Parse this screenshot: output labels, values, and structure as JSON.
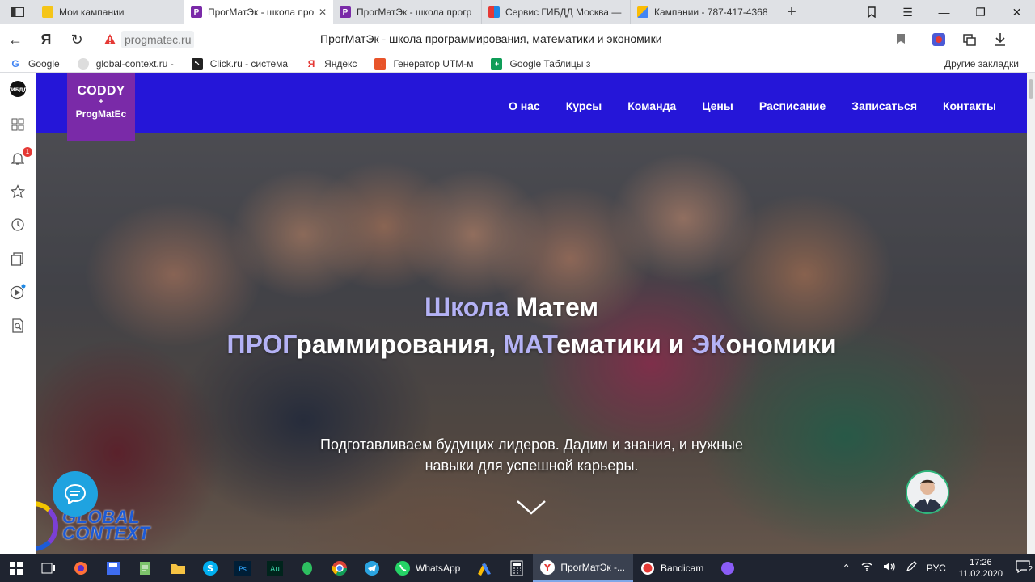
{
  "browser": {
    "tabs": [
      {
        "title": "Мои кампании",
        "favicon_color": "#f5c518",
        "favicon_glyph": "",
        "active": false
      },
      {
        "title": "ПрогМатЭк - школа про",
        "favicon_color": "#7a2aa8",
        "favicon_glyph": "P",
        "active": true
      },
      {
        "title": "ПрогМатЭк - школа прогр",
        "favicon_color": "#7a2aa8",
        "favicon_glyph": "P",
        "active": false
      },
      {
        "title": "Сервис ГИБДД Москва —",
        "favicon_color": "#e53935",
        "favicon_glyph": "",
        "active": false
      },
      {
        "title": "Кампании - 787-417-4368",
        "favicon_color": "#fbbc04",
        "favicon_glyph": "",
        "active": false
      }
    ],
    "url_host": "progmatec.ru",
    "page_title": "ПрогМатЭк - школа программирования, математики и экономики",
    "bookmarks": [
      {
        "label": "Google",
        "icon": "google-icon",
        "color": "#4285f4",
        "glyph": "G"
      },
      {
        "label": "global-context.ru -",
        "icon": "global-context-icon",
        "color": "#c9c9c9",
        "glyph": ""
      },
      {
        "label": "Click.ru - система",
        "icon": "cursor-icon",
        "color": "#222222",
        "glyph": "↖"
      },
      {
        "label": "Яндекс",
        "icon": "yandex-icon",
        "color": "#ffffff",
        "glyph": "Я"
      },
      {
        "label": "Генератор UTM-м",
        "icon": "utm-icon",
        "color": "#e8542a",
        "glyph": "→"
      },
      {
        "label": "Google Таблицы з",
        "icon": "sheets-icon",
        "color": "#0f9d58",
        "glyph": "+"
      }
    ],
    "other_bookmarks": "Другие закладки",
    "sidebar_logo": "ГИБДД",
    "notification_count": "1"
  },
  "site": {
    "logo": {
      "line1": "CODDY",
      "line2": "+",
      "line3": "ProgMatEc"
    },
    "menu": [
      "О нас",
      "Курсы",
      "Команда",
      "Цены",
      "Расписание",
      "Записаться",
      "Контакты"
    ],
    "headline1_accent": "Школа",
    "headline1_rest": " Матем",
    "headline2": {
      "a1": "ПРОГ",
      "r1": "раммирования, ",
      "a2": "МАТ",
      "r2": "ематики и ",
      "a3": "ЭК",
      "r3": "ономики"
    },
    "subtitle": "Подготавливаем будущих лидеров. Дадим и знания, и нужные навыки для успешной карьеры.",
    "brand_color": "#2516d8",
    "accent_color": "#b4b2f5"
  },
  "widgets": {
    "global_context_line1": "GLOBAL",
    "global_context_line2": "CONTEXT"
  },
  "taskbar": {
    "apps": [
      {
        "label": "WhatsApp",
        "active": false
      },
      {
        "label": "ПрогМатЭк -...",
        "active": true
      },
      {
        "label": "Bandicam",
        "active": false
      }
    ],
    "language": "РУС",
    "time": "17:26",
    "date": "11.02.2020",
    "notifications": "2"
  }
}
